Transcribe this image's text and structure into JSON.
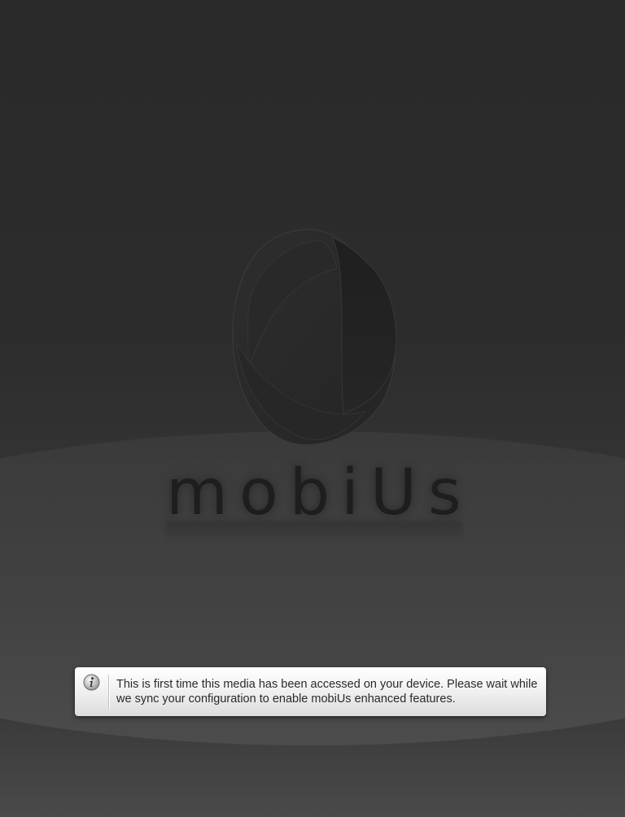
{
  "app": {
    "brand_name": "mobiUs"
  },
  "notification": {
    "icon": "info-icon",
    "message": "This is first time this media has been accessed on your device. Please wait while we sync your configuration to enable mobiUs enhanced features."
  },
  "colors": {
    "background": "#2a2a2a",
    "toast_background": "#f0f0f0",
    "toast_text": "#2a2a2a",
    "logo": "#222222"
  }
}
